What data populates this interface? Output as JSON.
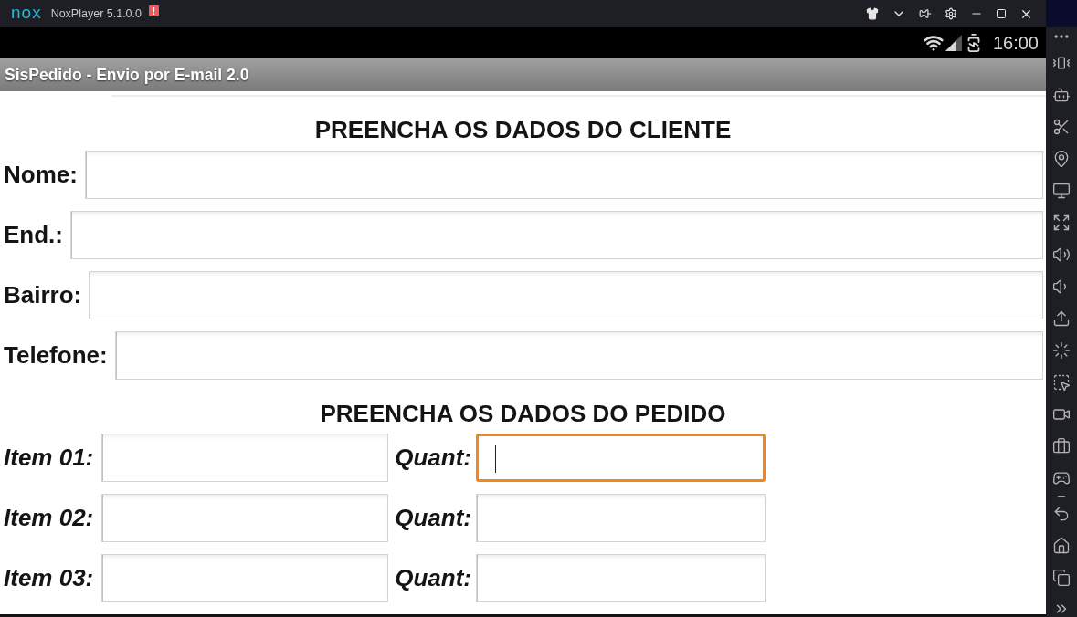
{
  "emulator": {
    "logo": "nox",
    "title": "NoxPlayer 5.1.0.0",
    "alert_badge": "!",
    "status_bar": {
      "time": "16:00"
    }
  },
  "app": {
    "title": "SisPedido - Envio por E-mail 2.0"
  },
  "client_section": {
    "heading": "PREENCHA OS DADOS DO CLIENTE",
    "fields": [
      {
        "label": "Nome:",
        "focused": false
      },
      {
        "label": "End.:",
        "focused": false
      },
      {
        "label": "Bairro:",
        "focused": false
      },
      {
        "label": "Telefone:",
        "focused": false
      }
    ]
  },
  "order_section": {
    "heading": "PREENCHA OS DADOS DO PEDIDO",
    "rows": [
      {
        "item": {
          "label": "Item 01:",
          "focused": false
        },
        "quantity": {
          "label": "Quant:",
          "focused": true
        }
      },
      {
        "item": {
          "label": "Item 02:",
          "focused": false
        },
        "quantity": {
          "label": "Quant:",
          "focused": false
        }
      },
      {
        "item": {
          "label": "Item 03:",
          "focused": false
        },
        "quantity": {
          "label": "Quant:",
          "focused": false
        }
      }
    ]
  }
}
